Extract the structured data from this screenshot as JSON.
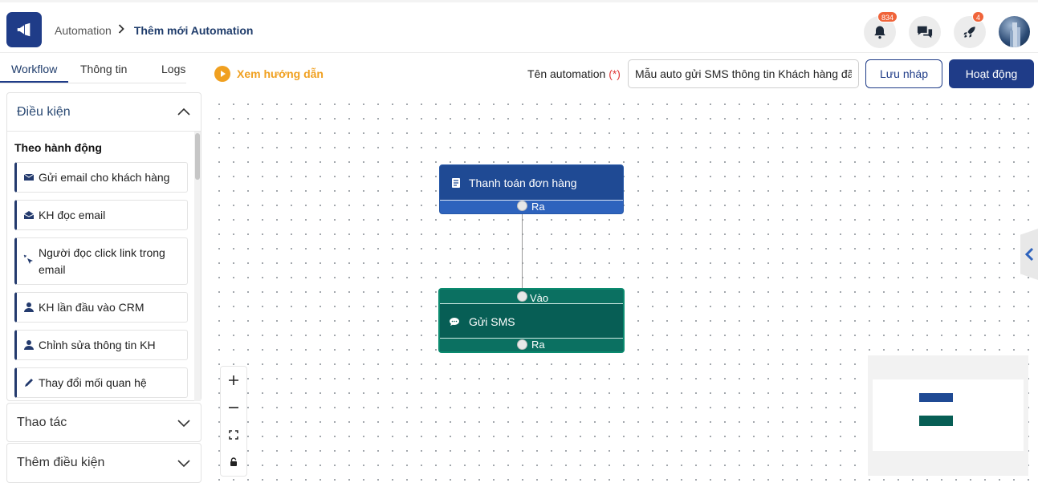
{
  "header": {
    "breadcrumb_root": "Automation",
    "breadcrumb_separator": ">",
    "breadcrumb_current": "Thêm mới Automation",
    "notifications_count": "834",
    "rocket_count": "4"
  },
  "tabs": [
    {
      "label": "Workflow"
    },
    {
      "label": "Thông tin"
    },
    {
      "label": "Logs"
    }
  ],
  "sidebar": {
    "conditions_title": "Điều kiện",
    "section_title": "Theo hành động",
    "items": [
      {
        "label": "Gửi email cho khách hàng",
        "icon": "envelope-icon"
      },
      {
        "label": "KH đọc email",
        "icon": "envelope-open-icon"
      },
      {
        "label": "Người đọc click link trong email",
        "icon": "click-pointer-icon"
      },
      {
        "label": "KH lần đầu vào CRM",
        "icon": "user-icon"
      },
      {
        "label": "Chỉnh sửa thông tin KH",
        "icon": "user-icon"
      },
      {
        "label": "Thay đổi mối quan hệ",
        "icon": "pencil-icon"
      }
    ],
    "actions_title": "Thao tác",
    "more_conditions_title": "Thêm điều kiện"
  },
  "toolbar": {
    "guide_label": "Xem hướng dẫn",
    "name_label": "Tên automation",
    "required_mark": "(*)",
    "name_value": "Mẫu auto gửi SMS thông tin Khách hàng đã thanh toán",
    "draft_label": "Lưu nháp",
    "activate_label": "Hoạt động"
  },
  "canvas": {
    "trigger_node": {
      "title": "Thanh toán đơn hàng",
      "out_label": "Ra"
    },
    "action_node": {
      "in_label": "Vào",
      "title": "Gửi SMS",
      "out_label": "Ra"
    }
  },
  "colors": {
    "primary": "#1f3c88",
    "trigger_node": "#1f4a94",
    "action_node": "#075e55",
    "accent_orange": "#f0a020",
    "badge": "#f0643a"
  }
}
